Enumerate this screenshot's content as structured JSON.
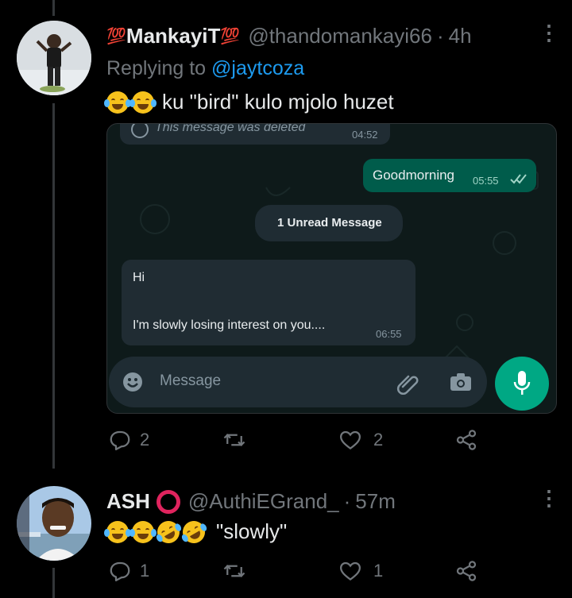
{
  "tweet1": {
    "name_prefix": "💯",
    "name": "MankayiT",
    "name_suffix": "💯",
    "handle": "@thandomankayi66",
    "dot": "·",
    "time": "4h",
    "replying_prefix": "Replying to ",
    "replying_handle": "@jaytcoza",
    "text": "ku \"bird\" kulo mjolo huzet",
    "media": {
      "deleted_text": "This message was deleted",
      "deleted_time": "04:52",
      "out_text": "Goodmorning",
      "out_time": "05:55",
      "unread_label": "1 Unread Message",
      "in_line1": "Hi",
      "in_line2": "I'm slowly losing interest on you....",
      "in_time": "06:55",
      "input_placeholder": "Message"
    },
    "replies": "2",
    "likes": "2"
  },
  "tweet2": {
    "name": "ASH",
    "handle": "@AuthiEGrand_",
    "dot": "·",
    "time": "57m",
    "text": "\"slowly\"",
    "replies": "1",
    "likes": "1"
  },
  "colors": {
    "background": "#000000",
    "link": "#1d9bf0",
    "secondary": "#71767b",
    "wa_outgoing": "#005c4b",
    "wa_incoming": "#202c33",
    "wa_mic": "#00a884"
  },
  "icons": [
    "more-icon",
    "reply-icon",
    "retweet-icon",
    "like-icon",
    "share-icon",
    "emoji-icon",
    "attach-icon",
    "camera-icon",
    "mic-icon",
    "check-icon"
  ]
}
